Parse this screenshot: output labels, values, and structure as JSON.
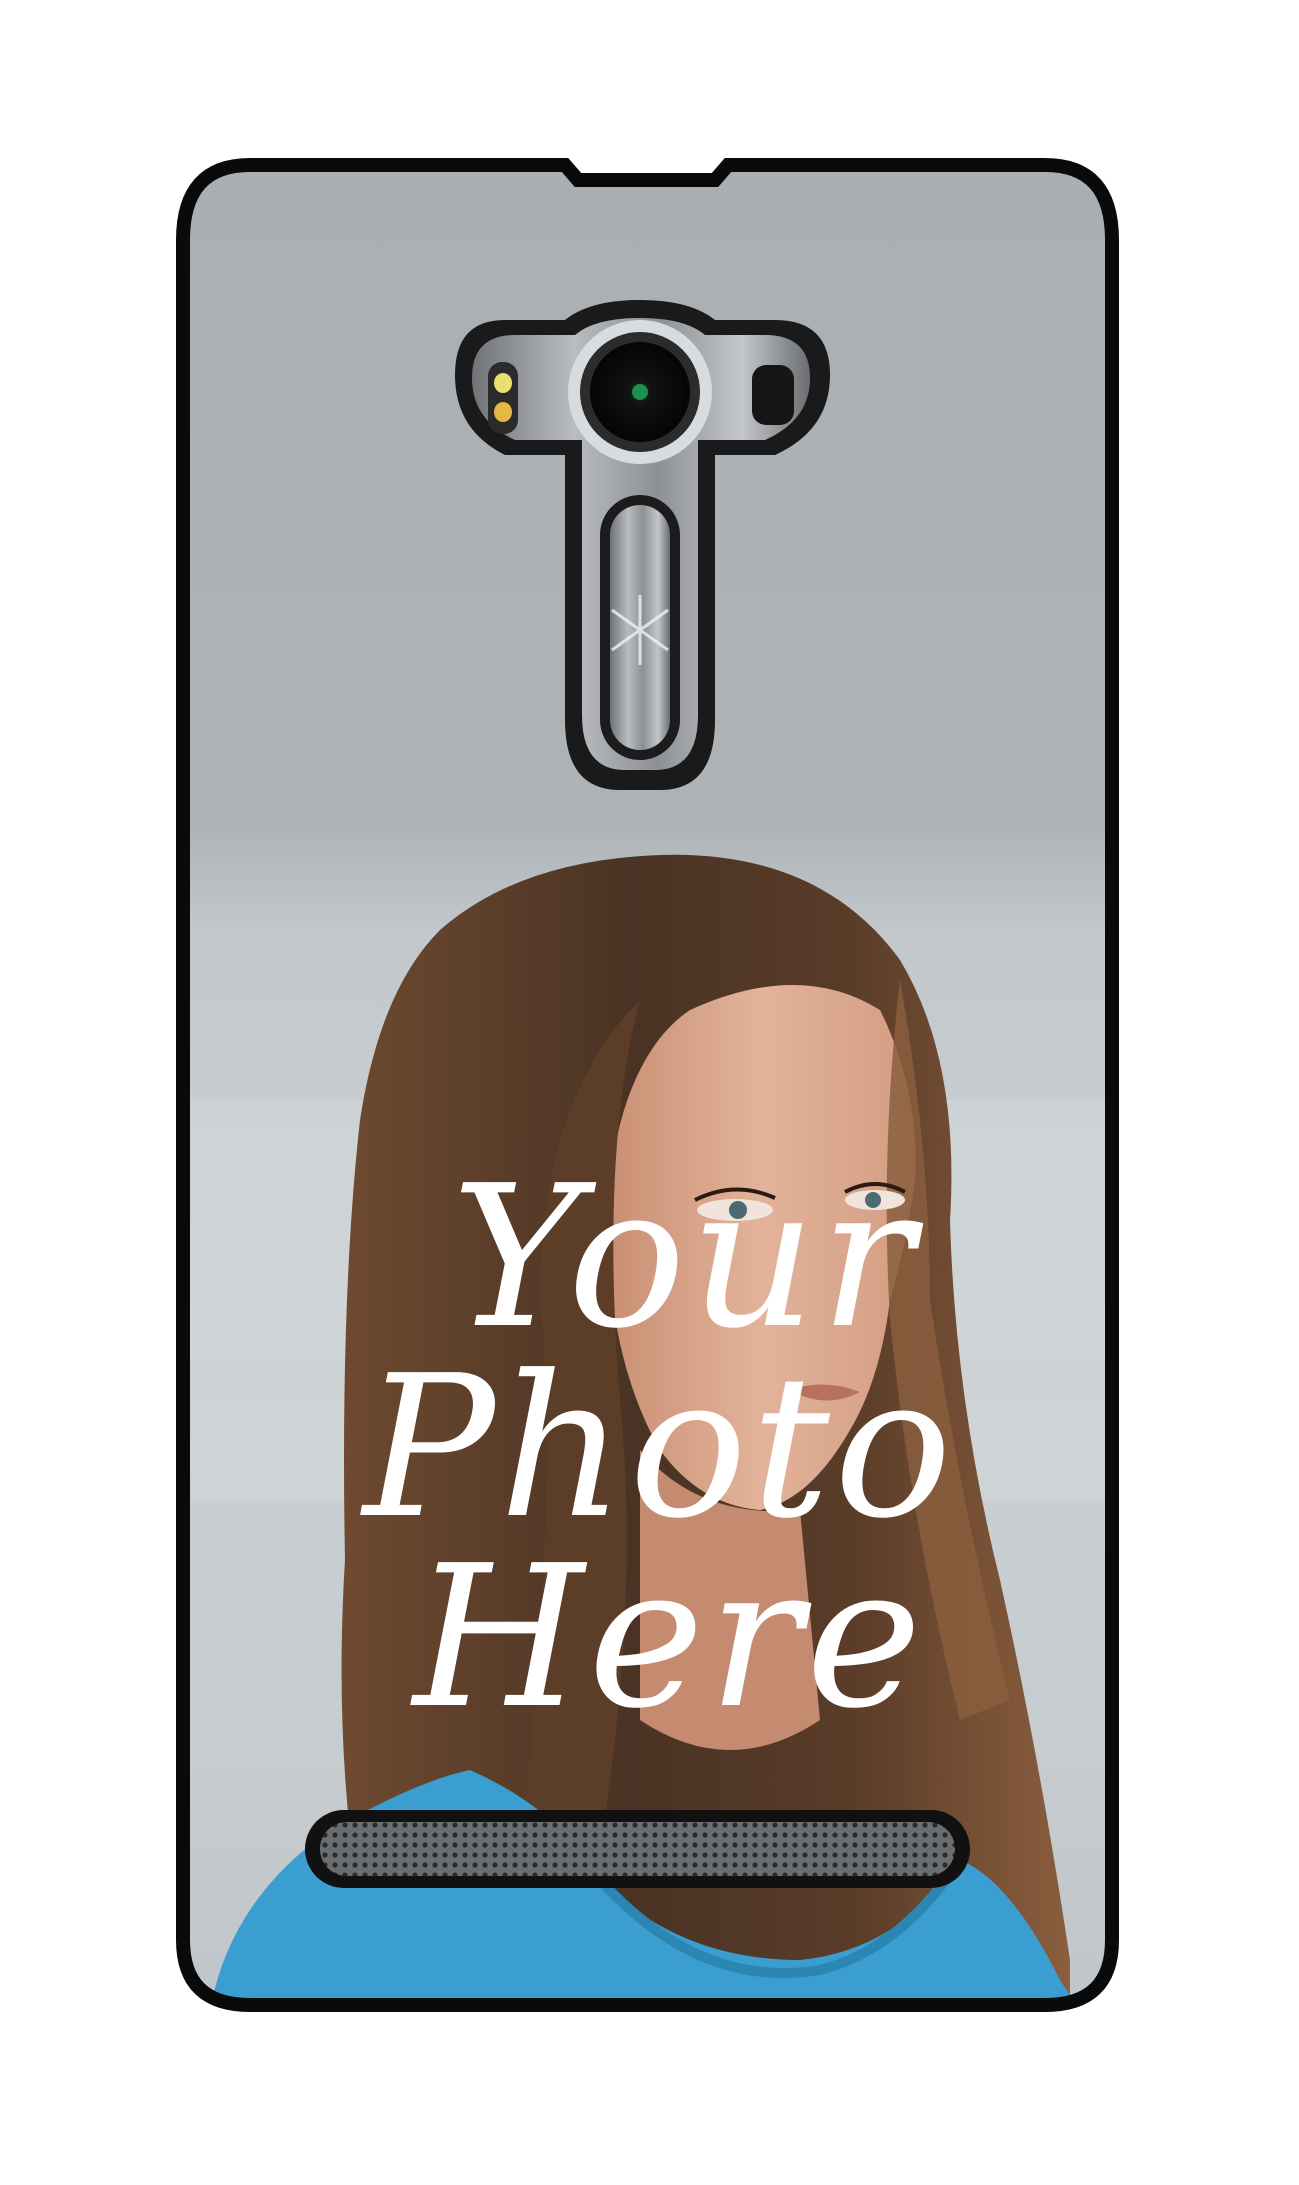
{
  "overlay": {
    "line1": "Your",
    "line2": "Photo",
    "line3": "Here"
  },
  "colors": {
    "case_border": "#0a0a0a",
    "case_fill": "#a9afb2",
    "sky_light": "#c9cfd2",
    "hair_dark": "#4a3324",
    "hair_mid": "#7a5236",
    "skin": "#d9a58a",
    "shirt": "#3a9fd0",
    "metal": "#9a9ea2",
    "overlay_text": "#ffffff"
  },
  "icons": {
    "camera": "camera-lens-icon",
    "flash": "flash-icon",
    "sensor": "laser-sensor-icon",
    "volume_key": "volume-key-icon",
    "speaker": "speaker-grille-icon"
  }
}
